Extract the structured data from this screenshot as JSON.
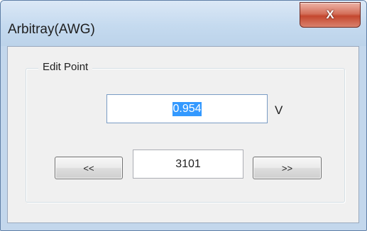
{
  "window": {
    "title": "Arbitray(AWG)",
    "close_label": "X"
  },
  "group": {
    "label": "Edit Point"
  },
  "value": {
    "text": "0.954",
    "unit": "V"
  },
  "navigation": {
    "prev_label": "<<",
    "index": "3101",
    "next_label": ">>"
  },
  "colors": {
    "selection": "#3399ff",
    "close_button": "#c4472f",
    "frame": "#c3d7ec",
    "client": "#f0f0f0"
  }
}
